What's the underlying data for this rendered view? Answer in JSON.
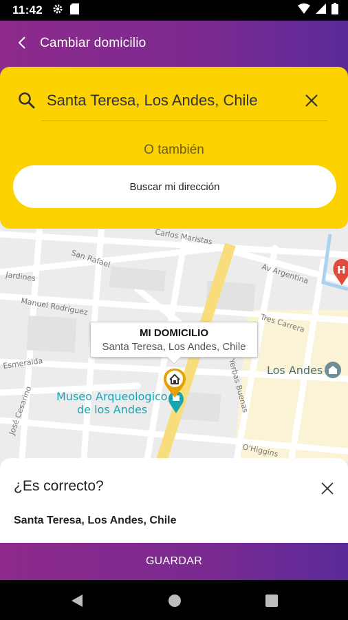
{
  "status_bar": {
    "time": "11:42",
    "icons_left": [
      "gear-icon",
      "sim-card-icon"
    ],
    "icons_right": [
      "wifi-icon",
      "signal-icon",
      "battery-icon"
    ]
  },
  "app_bar": {
    "back_icon": "chevron-left-icon",
    "title": "Cambiar domicilio"
  },
  "search": {
    "icon": "search-icon",
    "value": "Santa Teresa, Los Andes, Chile",
    "clear_icon": "close-icon",
    "alt_text": "O también",
    "locate_button": "Buscar mi dirección"
  },
  "map": {
    "streets": [
      "Carlos Maristas",
      "San Rafael",
      "Av Argentina",
      "Jardines",
      "Manuel Rodríguez",
      "Tres Carrera",
      "Esmeralda",
      "José Cesarino",
      "Yerbas Buenas",
      "O'Higgins"
    ],
    "places": [
      {
        "name": "Los Andes",
        "icon": "city-landmark-icon"
      },
      {
        "name": "Museo Arqueologico de los Andes",
        "icon": "museum-pin-icon"
      },
      {
        "name": "H",
        "icon": "hospital-pin-icon"
      }
    ],
    "callout": {
      "title": "MI DOMICILIO",
      "subtitle": "Santa Teresa, Los Andes, Chile"
    },
    "marker_icon": "home-pin-icon",
    "colors": {
      "road": "#ffffff",
      "main_road": "#f8dd7c",
      "block": "#e8e8e8",
      "center_area": "#fbf3d6",
      "water_line": "#a8d4f0",
      "museum": "#19a4b4"
    }
  },
  "confirm": {
    "title": "¿Es correcto?",
    "close_icon": "close-icon",
    "address": "Santa Teresa, Los Andes, Chile"
  },
  "save_button": "GUARDAR",
  "nav_bar": {
    "buttons": [
      "back-triangle-icon",
      "home-circle-icon",
      "recents-square-icon"
    ]
  },
  "colors": {
    "brand_purple": "#7a2a91",
    "accent_yellow": "#fcd200"
  }
}
